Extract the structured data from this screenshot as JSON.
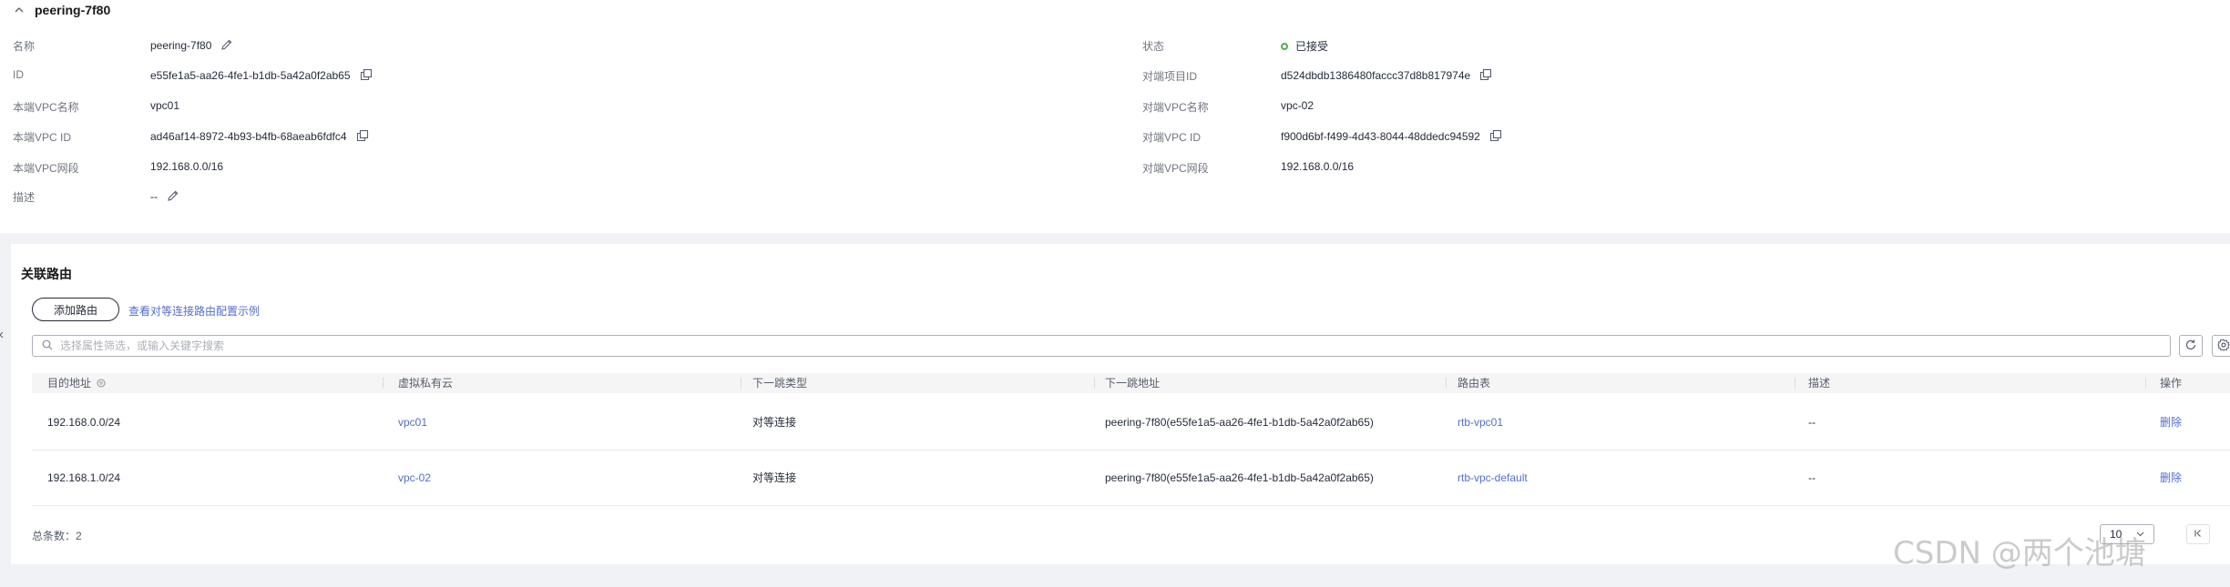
{
  "detail": {
    "title": "peering-7f80",
    "left_fields": [
      {
        "label": "名称",
        "value": "peering-7f80"
      },
      {
        "label": "ID",
        "value": "e55fe1a5-aa26-4fe1-b1db-5a42a0f2ab65"
      },
      {
        "label": "本端VPC名称",
        "value": "vpc01"
      },
      {
        "label": "本端VPC ID",
        "value": "ad46af14-8972-4b93-b4fb-68aeab6fdfc4"
      },
      {
        "label": "本端VPC网段",
        "value": "192.168.0.0/16"
      },
      {
        "label": "描述",
        "value": "--"
      }
    ],
    "right_fields": [
      {
        "label": "状态",
        "value": "已接受"
      },
      {
        "label": "对端项目ID",
        "value": "d524dbdb1386480faccc37d8b817974e"
      },
      {
        "label": "对端VPC名称",
        "value": "vpc-02"
      },
      {
        "label": "对端VPC ID",
        "value": "f900d6bf-f499-4d43-8044-48ddedc94592"
      },
      {
        "label": "对端VPC网段",
        "value": "192.168.0.0/16"
      }
    ]
  },
  "routes": {
    "title": "关联路由",
    "add_button": "添加路由",
    "example_link": "查看对等连接路由配置示例",
    "search_placeholder": "选择属性筛选，或输入关键字搜索",
    "columns": [
      "目的地址",
      "虚拟私有云",
      "下一跳类型",
      "下一跳地址",
      "路由表",
      "描述",
      "操作"
    ],
    "rows": [
      [
        "192.168.0.0/24",
        "vpc01",
        "对等连接",
        "peering-7f80(e55fe1a5-aa26-4fe1-b1db-5a42a0f2ab65)",
        "rtb-vpc01",
        "--",
        "删除"
      ],
      [
        "192.168.1.0/24",
        "vpc-02",
        "对等连接",
        "peering-7f80(e55fe1a5-aa26-4fe1-b1db-5a42a0f2ab65)",
        "rtb-vpc-default",
        "--",
        "删除"
      ]
    ],
    "total_label": "总条数：2",
    "page_size": "10"
  },
  "watermark": "CSDN @两个池塘",
  "colors": {
    "link": "#526ecc",
    "status_ok": "#50b050",
    "page_bg": "#f0f2f5"
  }
}
